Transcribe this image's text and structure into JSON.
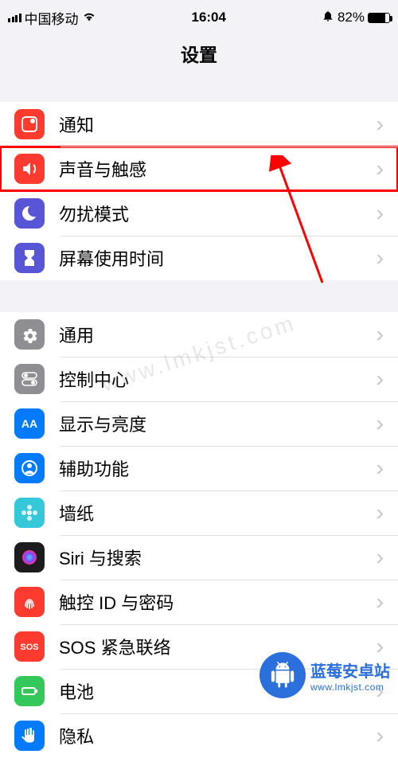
{
  "status": {
    "carrier": "中国移动",
    "time": "16:04",
    "battery": "82%"
  },
  "title": "设置",
  "groups": [
    {
      "rows": [
        {
          "id": "notifications",
          "label": "通知",
          "color": "#ff3b30",
          "icon": "bell",
          "highlight": false
        },
        {
          "id": "sounds",
          "label": "声音与触感",
          "color": "#ff3b30",
          "icon": "speaker",
          "highlight": true
        },
        {
          "id": "dnd",
          "label": "勿扰模式",
          "color": "#5856d6",
          "icon": "moon",
          "highlight": false
        },
        {
          "id": "screentime",
          "label": "屏幕使用时间",
          "color": "#5856d6",
          "icon": "hourglass",
          "highlight": false
        }
      ]
    },
    {
      "rows": [
        {
          "id": "general",
          "label": "通用",
          "color": "#8e8e93",
          "icon": "gear",
          "highlight": false
        },
        {
          "id": "controlcenter",
          "label": "控制中心",
          "color": "#8e8e93",
          "icon": "switches",
          "highlight": false
        },
        {
          "id": "display",
          "label": "显示与亮度",
          "color": "#007aff",
          "icon": "aa",
          "highlight": false
        },
        {
          "id": "accessibility",
          "label": "辅助功能",
          "color": "#007aff",
          "icon": "person",
          "highlight": false
        },
        {
          "id": "wallpaper",
          "label": "墙纸",
          "color": "#34c8d9",
          "icon": "flower",
          "highlight": false
        },
        {
          "id": "siri",
          "label": "Siri 与搜索",
          "color": "#1c1c1e",
          "icon": "siri",
          "highlight": false
        },
        {
          "id": "touchid",
          "label": "触控 ID 与密码",
          "color": "#ff3b30",
          "icon": "fingerprint",
          "highlight": false
        },
        {
          "id": "sos",
          "label": "SOS 紧急联络",
          "color": "#ff3b30",
          "icon": "sos",
          "highlight": false
        },
        {
          "id": "battery",
          "label": "电池",
          "color": "#34c759",
          "icon": "battery",
          "highlight": false
        },
        {
          "id": "privacy",
          "label": "隐私",
          "color": "#007aff",
          "icon": "hand",
          "highlight": false
        }
      ]
    }
  ],
  "icon_label": {
    "sos": "SOS",
    "aa": "AA"
  },
  "watermark": {
    "center": "www.lmkjst.com",
    "brand_cn": "蓝莓安卓站",
    "brand_url": "www.lmkjst.com"
  }
}
